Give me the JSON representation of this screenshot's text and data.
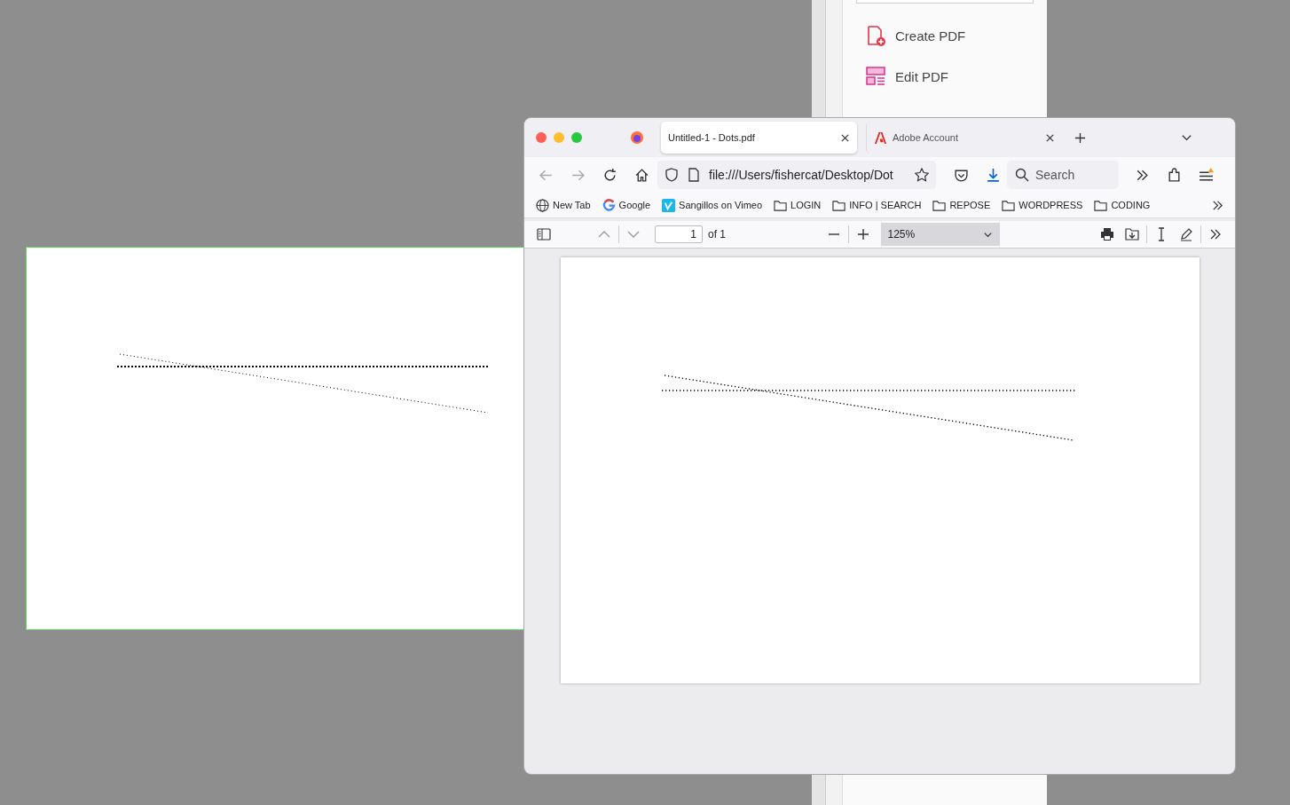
{
  "adobe_panel": {
    "items": [
      {
        "label": "Create PDF",
        "kind": "create"
      },
      {
        "label": "Edit PDF",
        "kind": "edit"
      }
    ]
  },
  "browser": {
    "tabs": [
      {
        "label": "Untitled-1 - Dots.pdf",
        "selected": true,
        "kind": "file"
      },
      {
        "label": "Adobe Account",
        "selected": false,
        "kind": "adobe"
      }
    ],
    "url": "file:///Users/fishercat/Desktop/Dot",
    "search": {
      "placeholder": "Search"
    },
    "bookmarks": [
      {
        "label": "New Tab",
        "kind": "globe"
      },
      {
        "label": "Google",
        "kind": "google"
      },
      {
        "label": "Sangillos on Vimeo",
        "kind": "vimeo"
      },
      {
        "label": "LOGIN",
        "kind": "folder"
      },
      {
        "label": "INFO | SEARCH",
        "kind": "folder"
      },
      {
        "label": "REPOSE",
        "kind": "folder"
      },
      {
        "label": "WORDPRESS",
        "kind": "folder"
      },
      {
        "label": "CODING",
        "kind": "folder"
      }
    ],
    "pdf_toolbar": {
      "page": "1",
      "page_count": "of 1",
      "zoom": "125%"
    }
  }
}
